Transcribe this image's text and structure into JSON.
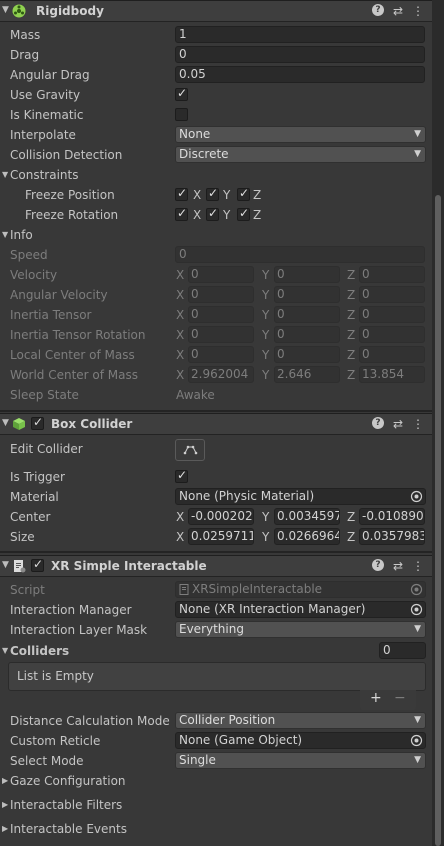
{
  "rigidbody": {
    "title": "Rigidbody",
    "mass_label": "Mass",
    "mass_value": "1",
    "drag_label": "Drag",
    "drag_value": "0",
    "angular_drag_label": "Angular Drag",
    "angular_drag_value": "0.05",
    "use_gravity_label": "Use Gravity",
    "use_gravity": true,
    "is_kinematic_label": "Is Kinematic",
    "is_kinematic": false,
    "interpolate_label": "Interpolate",
    "interpolate_value": "None",
    "collision_detection_label": "Collision Detection",
    "collision_detection_value": "Discrete",
    "constraints_label": "Constraints",
    "freeze_position_label": "Freeze Position",
    "freeze_rotation_label": "Freeze Rotation",
    "axis_x": "X",
    "axis_y": "Y",
    "axis_z": "Z",
    "info": {
      "label": "Info",
      "speed_label": "Speed",
      "speed_value": "0",
      "velocity_label": "Velocity",
      "velocity": [
        "0",
        "0",
        "0"
      ],
      "angular_velocity_label": "Angular Velocity",
      "angular_velocity": [
        "0",
        "0",
        "0"
      ],
      "inertia_tensor_label": "Inertia Tensor",
      "inertia_tensor": [
        "0",
        "0",
        "0"
      ],
      "inertia_tensor_rotation_label": "Inertia Tensor Rotation",
      "inertia_tensor_rotation": [
        "0",
        "0",
        "0"
      ],
      "local_center_label": "Local Center of Mass",
      "local_center": [
        "0",
        "0",
        "0"
      ],
      "world_center_label": "World Center of Mass",
      "world_center": [
        "2.962004",
        "2.646",
        "13.854"
      ],
      "sleep_state_label": "Sleep State",
      "sleep_state_value": "Awake"
    }
  },
  "box_collider": {
    "title": "Box Collider",
    "edit_collider_label": "Edit Collider",
    "is_trigger_label": "Is Trigger",
    "is_trigger": true,
    "material_label": "Material",
    "material_value": "None (Physic Material)",
    "center_label": "Center",
    "center": [
      "-0.000202",
      "0.0034597",
      "-0.010890"
    ],
    "size_label": "Size",
    "size": [
      "0.0259711",
      "0.0266964",
      "0.0357983"
    ]
  },
  "xr_interactable": {
    "title": "XR Simple Interactable",
    "script_label": "Script",
    "script_value": "XRSimpleInteractable",
    "interaction_manager_label": "Interaction Manager",
    "interaction_manager_value": "None (XR Interaction Manager)",
    "interaction_layer_mask_label": "Interaction Layer Mask",
    "interaction_layer_mask_value": "Everything",
    "colliders_label": "Colliders",
    "colliders_count": "0",
    "list_empty_text": "List is Empty",
    "plus": "+",
    "minus": "−",
    "distance_calc_label": "Distance Calculation Mode",
    "distance_calc_value": "Collider Position",
    "custom_reticle_label": "Custom Reticle",
    "custom_reticle_value": "None (Game Object)",
    "select_mode_label": "Select Mode",
    "select_mode_value": "Single",
    "gaze_config_label": "Gaze Configuration",
    "interactable_filters_label": "Interactable Filters",
    "interactable_events_label": "Interactable Events"
  },
  "header_icons": {
    "help": "?",
    "presets": "⇄",
    "menu": "⋮"
  }
}
